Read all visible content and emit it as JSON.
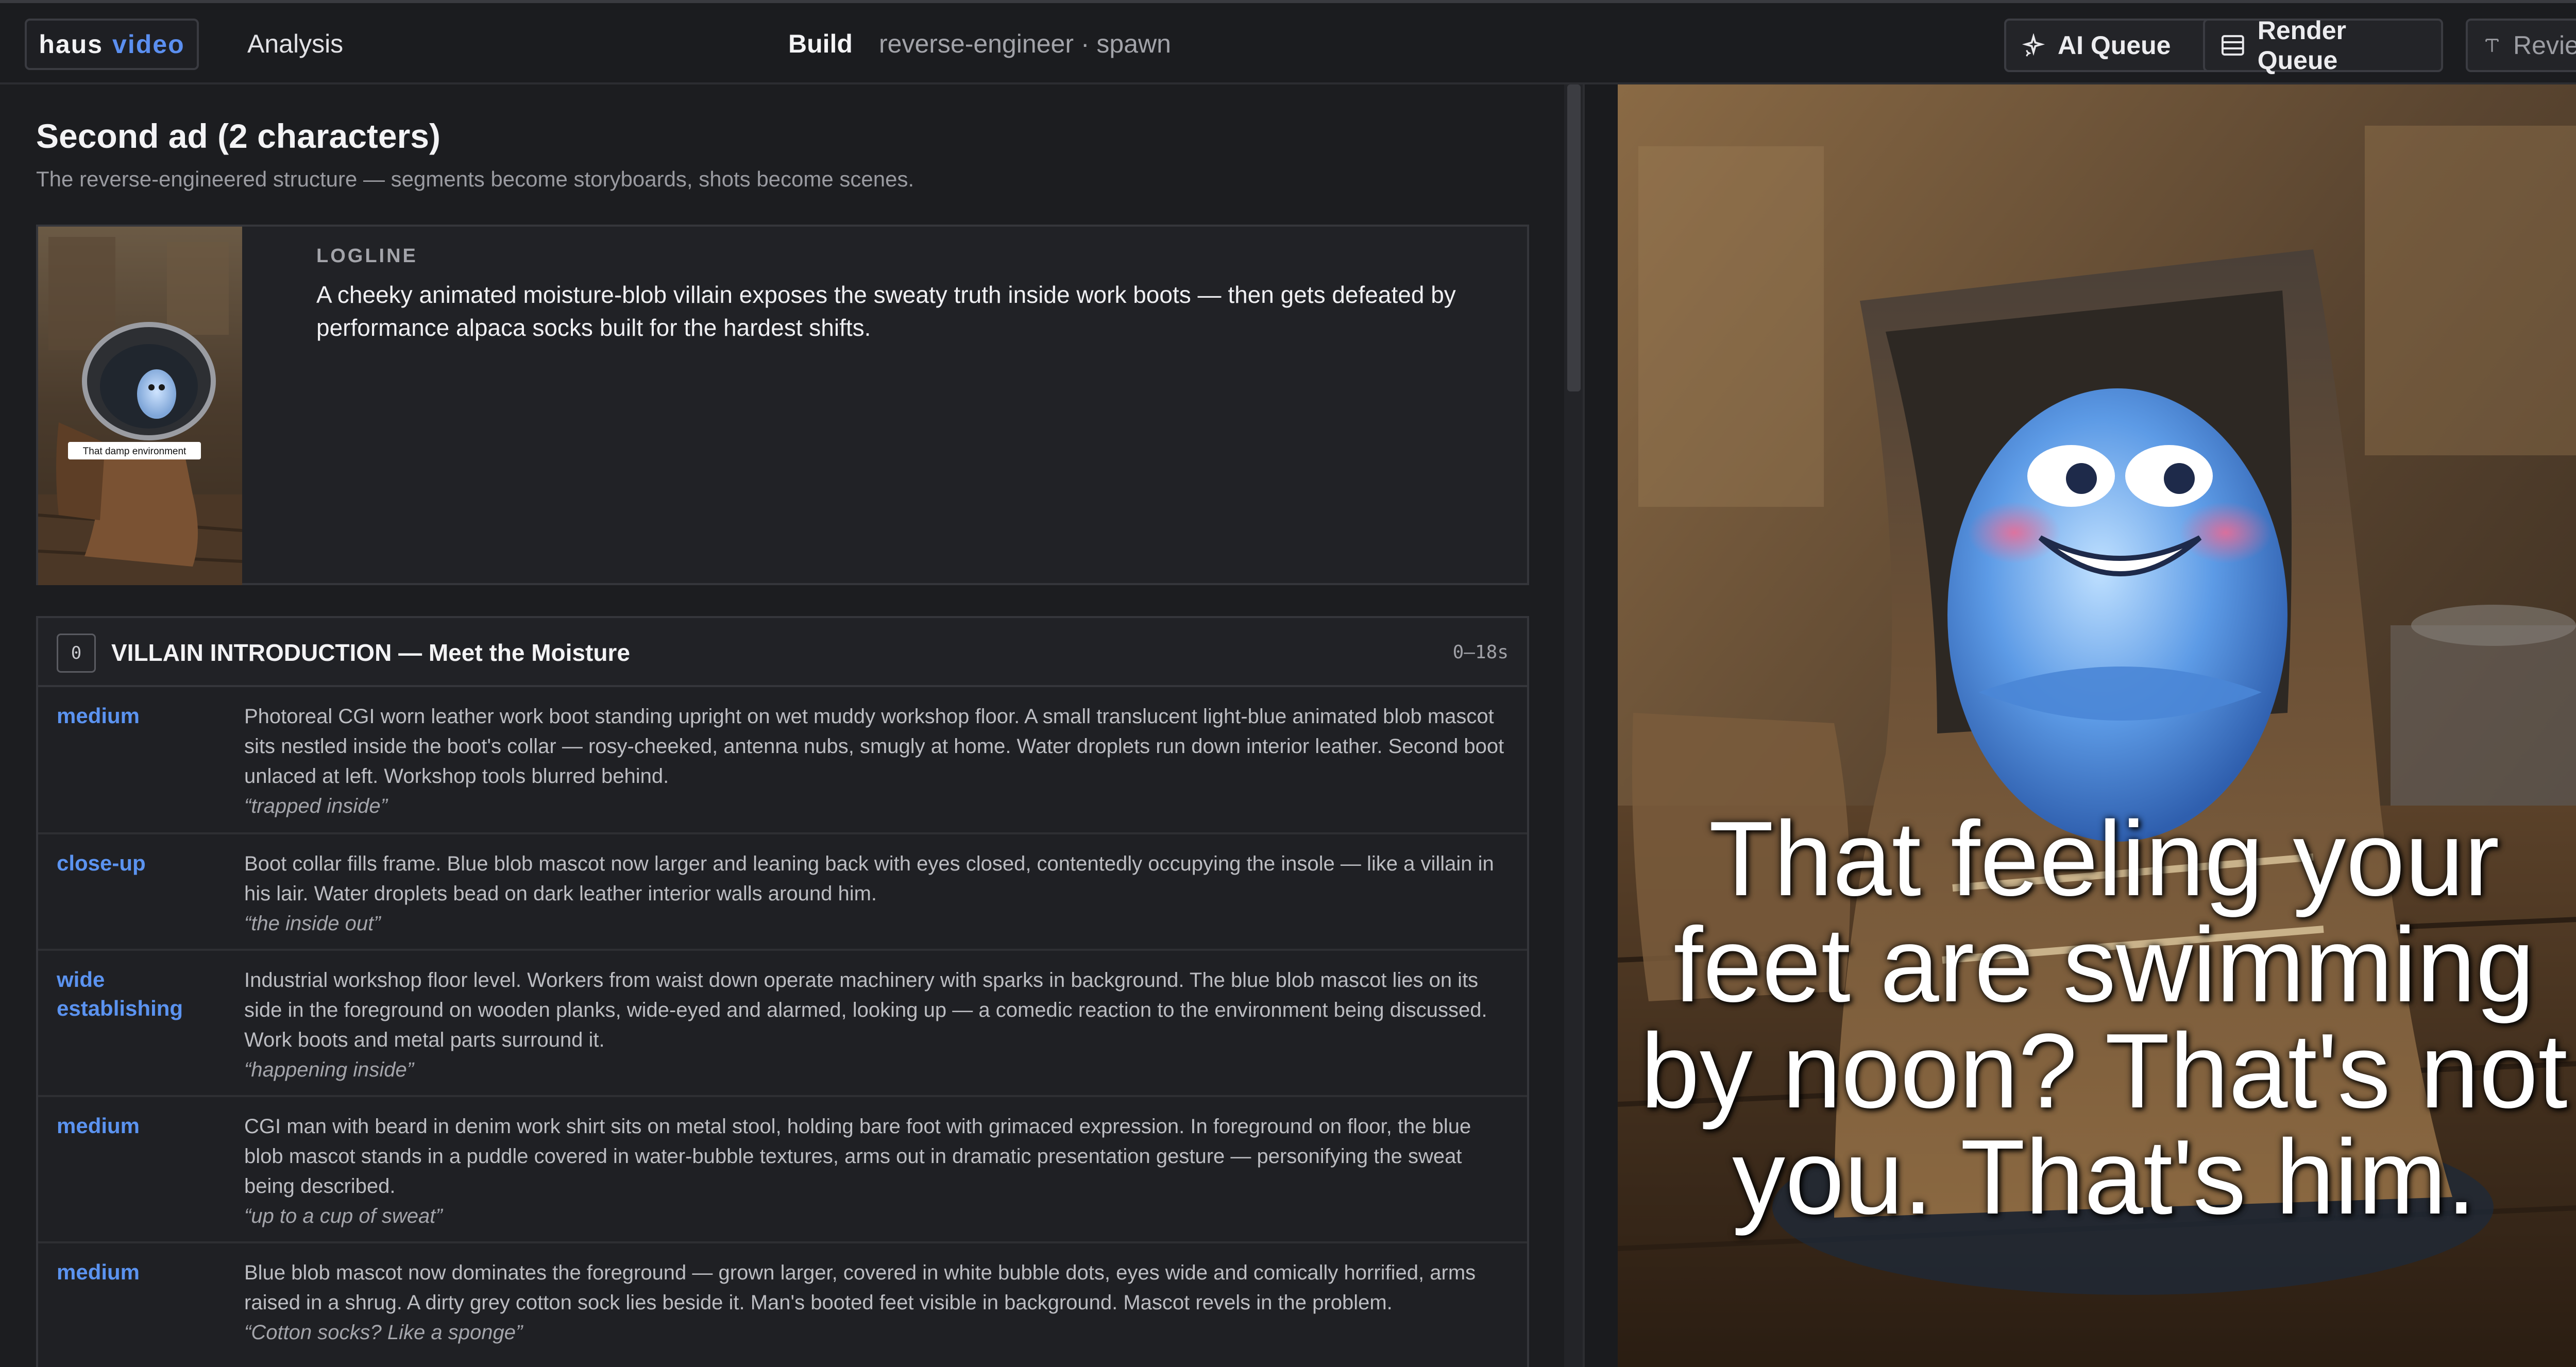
{
  "brand": {
    "word1": "haus",
    "word2": "video"
  },
  "nav": {
    "analysis": "Analysis",
    "build": "Build",
    "breadcrumb": "reverse-engineer · spawn"
  },
  "toolbar": {
    "ai_queue": "AI Queue",
    "render_queue": "Render Queue",
    "review": "Review"
  },
  "icons": {
    "ai_queue": "sparkle-icon",
    "render_queue": "queue-list-icon",
    "review": "text-icon"
  },
  "colors": {
    "accent": "#5b8ff0",
    "shot_type": "#5b93f0",
    "background": "#1c1d20"
  },
  "project": {
    "title": "Second ad (2 characters)",
    "subtitle": "The reverse-engineered structure — segments become storyboards, shots become scenes."
  },
  "logline": {
    "label": "LOGLINE",
    "text": "A cheeky animated moisture-blob villain exposes the sweaty truth inside work boots — then gets defeated by performance alpaca socks built for the hardest shifts.",
    "thumbnail_caption": "That damp environment"
  },
  "segment": {
    "index": "0",
    "title": "VILLAIN INTRODUCTION — Meet the Moisture",
    "time": "0–18s",
    "shots": [
      {
        "type": "medium",
        "description": "Photoreal CGI worn leather work boot standing upright on wet muddy workshop floor. A small translucent light-blue animated blob mascot sits nestled inside the boot's collar — rosy-cheeked, antenna nubs, smugly at home. Water droplets run down interior leather. Second boot unlaced at left. Workshop tools blurred behind.",
        "quote": "“trapped inside”"
      },
      {
        "type": "close-up",
        "description": "Boot collar fills frame. Blue blob mascot now larger and leaning back with eyes closed, contentedly occupying the insole — like a villain in his lair. Water droplets bead on dark leather interior walls around him.",
        "quote": "“the inside out”"
      },
      {
        "type": "wide establishing",
        "description": "Industrial workshop floor level. Workers from waist down operate machinery with sparks in background. The blue blob mascot lies on its side in the foreground on wooden planks, wide-eyed and alarmed, looking up — a comedic reaction to the environment being discussed. Work boots and metal parts surround it.",
        "quote": "“happening inside”"
      },
      {
        "type": "medium",
        "description": "CGI man with beard in denim work shirt sits on metal stool, holding bare foot with grimaced expression. In foreground on floor, the blue blob mascot stands in a puddle covered in water-bubble textures, arms out in dramatic presentation gesture — personifying the sweat being described.",
        "quote": "“up to a cup of sweat”"
      },
      {
        "type": "medium",
        "description": "Blue blob mascot now dominates the foreground — grown larger, covered in white bubble dots, eyes wide and comically horrified, arms raised in a shrug. A dirty grey cotton sock lies beside it. Man's booted feet visible in background. Mascot revels in the problem.",
        "quote": "“Cotton socks? Like a sponge”"
      }
    ]
  },
  "preview": {
    "caption": "That feeling your feet are swimming by noon? That's not you. That's him."
  }
}
